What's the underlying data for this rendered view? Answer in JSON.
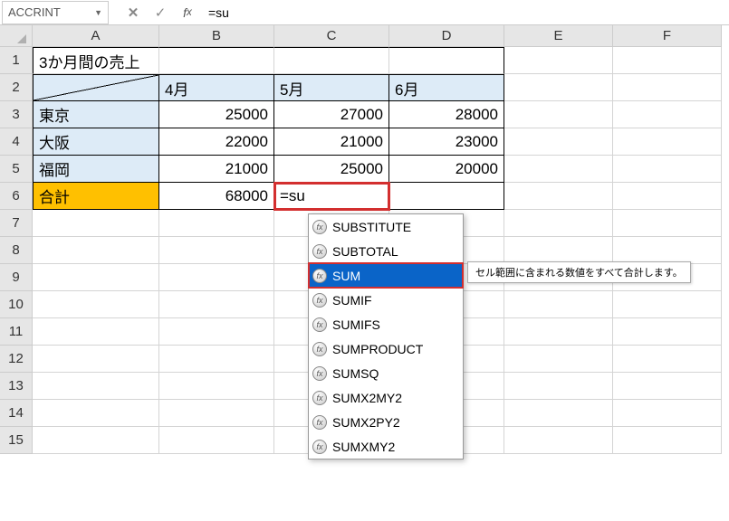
{
  "nameBox": "ACCRINT",
  "formulaInput": "=su",
  "colHeaders": [
    "A",
    "B",
    "C",
    "D",
    "E",
    "F"
  ],
  "rowHeaders": [
    "1",
    "2",
    "3",
    "4",
    "5",
    "6",
    "7",
    "8",
    "9",
    "10",
    "11",
    "12",
    "13",
    "14",
    "15"
  ],
  "data": {
    "title": "3か月間の売上",
    "months": {
      "b": "4月",
      "c": "5月",
      "d": "6月"
    },
    "rows": [
      {
        "label": "東京",
        "b": "25000",
        "c": "27000",
        "d": "28000"
      },
      {
        "label": "大阪",
        "b": "22000",
        "c": "21000",
        "d": "23000"
      },
      {
        "label": "福岡",
        "b": "21000",
        "c": "25000",
        "d": "20000"
      }
    ],
    "total": {
      "label": "合計",
      "b": "68000",
      "c": "=su",
      "d": ""
    }
  },
  "autocomplete": {
    "items": [
      "SUBSTITUTE",
      "SUBTOTAL",
      "SUM",
      "SUMIF",
      "SUMIFS",
      "SUMPRODUCT",
      "SUMSQ",
      "SUMX2MY2",
      "SUMX2PY2",
      "SUMXMY2"
    ],
    "selectedIndex": 2,
    "tooltip": "セル範囲に含まれる数値をすべて合計します。"
  }
}
